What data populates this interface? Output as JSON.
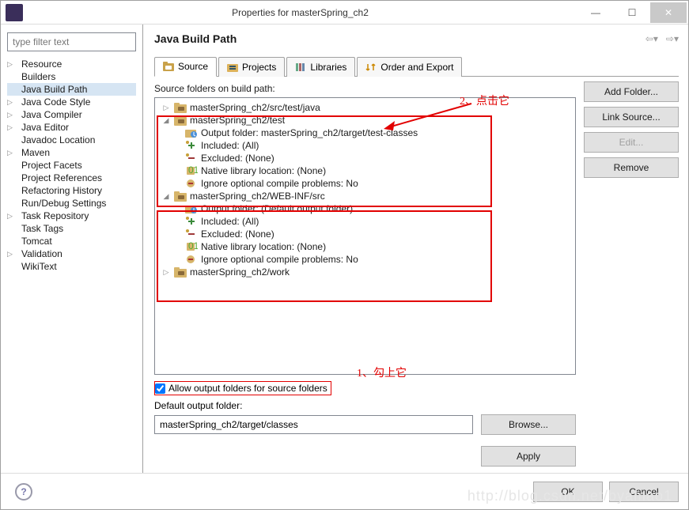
{
  "window": {
    "title": "Properties for masterSpring_ch2"
  },
  "filter": {
    "placeholder": "type filter text"
  },
  "sidebar": {
    "items": [
      {
        "label": "Resource",
        "expandable": true,
        "selected": false
      },
      {
        "label": "Builders",
        "expandable": false,
        "selected": false
      },
      {
        "label": "Java Build Path",
        "expandable": false,
        "selected": true
      },
      {
        "label": "Java Code Style",
        "expandable": true,
        "selected": false
      },
      {
        "label": "Java Compiler",
        "expandable": true,
        "selected": false
      },
      {
        "label": "Java Editor",
        "expandable": true,
        "selected": false
      },
      {
        "label": "Javadoc Location",
        "expandable": false,
        "selected": false
      },
      {
        "label": "Maven",
        "expandable": true,
        "selected": false
      },
      {
        "label": "Project Facets",
        "expandable": false,
        "selected": false
      },
      {
        "label": "Project References",
        "expandable": false,
        "selected": false
      },
      {
        "label": "Refactoring History",
        "expandable": false,
        "selected": false
      },
      {
        "label": "Run/Debug Settings",
        "expandable": false,
        "selected": false
      },
      {
        "label": "Task Repository",
        "expandable": true,
        "selected": false
      },
      {
        "label": "Task Tags",
        "expandable": false,
        "selected": false
      },
      {
        "label": "Tomcat",
        "expandable": false,
        "selected": false
      },
      {
        "label": "Validation",
        "expandable": true,
        "selected": false
      },
      {
        "label": "WikiText",
        "expandable": false,
        "selected": false
      }
    ]
  },
  "content": {
    "title": "Java Build Path",
    "tabs": [
      {
        "label": "Source",
        "active": true,
        "icon": "source-folder-icon"
      },
      {
        "label": "Projects",
        "active": false,
        "icon": "projects-icon"
      },
      {
        "label": "Libraries",
        "active": false,
        "icon": "libraries-icon"
      },
      {
        "label": "Order and Export",
        "active": false,
        "icon": "order-icon"
      }
    ],
    "source_caption": "Source folders on build path:",
    "source_folders": [
      {
        "name": "masterSpring_ch2/src/test/java",
        "expanded": false,
        "children": []
      },
      {
        "name": "masterSpring_ch2/test",
        "expanded": true,
        "children": [
          {
            "label": "Output folder: masterSpring_ch2/target/test-classes",
            "icon": "output-folder-icon"
          },
          {
            "label": "Included: (All)",
            "icon": "include-icon"
          },
          {
            "label": "Excluded: (None)",
            "icon": "exclude-icon"
          },
          {
            "label": "Native library location: (None)",
            "icon": "native-lib-icon"
          },
          {
            "label": "Ignore optional compile problems: No",
            "icon": "ignore-icon"
          }
        ]
      },
      {
        "name": "masterSpring_ch2/WEB-INF/src",
        "expanded": true,
        "children": [
          {
            "label": "Output folder: (Default output folder)",
            "icon": "output-folder-icon"
          },
          {
            "label": "Included: (All)",
            "icon": "include-icon"
          },
          {
            "label": "Excluded: (None)",
            "icon": "exclude-icon"
          },
          {
            "label": "Native library location: (None)",
            "icon": "native-lib-icon"
          },
          {
            "label": "Ignore optional compile problems: No",
            "icon": "ignore-icon"
          }
        ]
      },
      {
        "name": "masterSpring_ch2/work",
        "expanded": false,
        "children": []
      }
    ],
    "buttons": {
      "add_folder": "Add Folder...",
      "link_source": "Link Source...",
      "edit": "Edit...",
      "remove": "Remove",
      "browse": "Browse...",
      "apply": "Apply"
    },
    "allow_checkbox": {
      "label": "Allow output folders for source folders",
      "checked": true
    },
    "default_output_label": "Default output folder:",
    "default_output_value": "masterSpring_ch2/target/classes"
  },
  "footer": {
    "ok": "OK",
    "cancel": "Cancel"
  },
  "annotations": {
    "a1": "1、勾上它",
    "a2": "2、点击它"
  },
  "watermark": "http://blog.csdn.net/byamao1"
}
